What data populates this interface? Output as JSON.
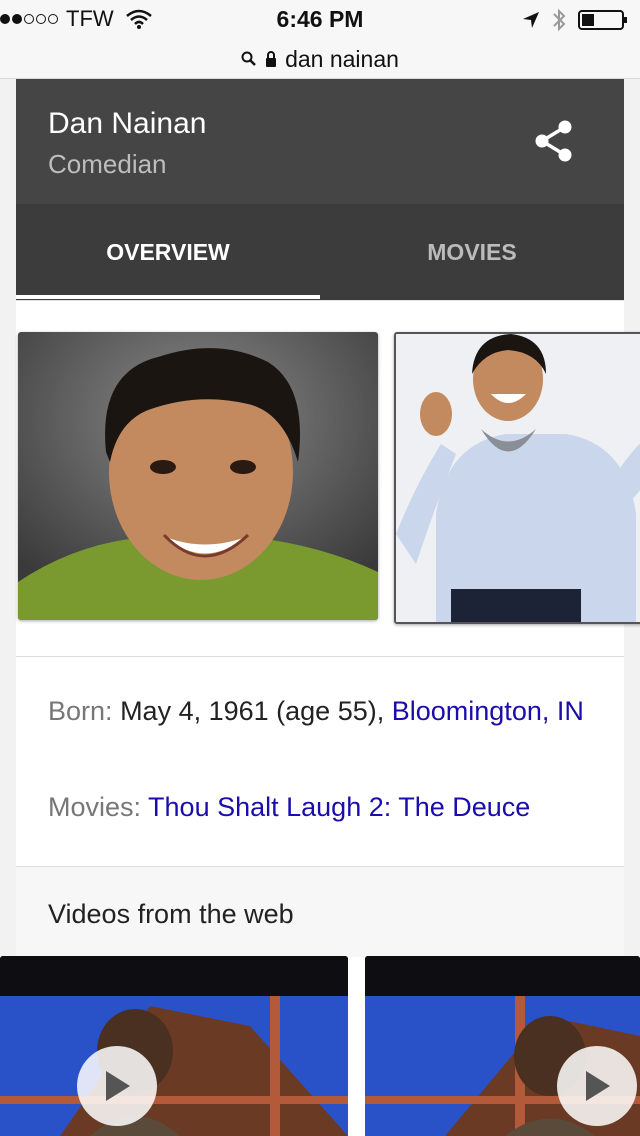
{
  "status": {
    "carrier": "TFW",
    "time": "6:46 PM",
    "signal_dots_filled": 2,
    "signal_dots_total": 5
  },
  "url_bar": {
    "query": "dan nainan"
  },
  "entity": {
    "name": "Dan Nainan",
    "subtitle": "Comedian"
  },
  "tabs": [
    {
      "label": "OVERVIEW",
      "active": true
    },
    {
      "label": "MOVIES",
      "active": false
    }
  ],
  "facts": {
    "born_label": "Born:",
    "born_value": "May 4, 1961 (age 55),",
    "born_place": "Bloomington, IN",
    "movies_label": "Movies:",
    "movies_value": "Thou Shalt Laugh 2: The Deuce"
  },
  "videos": {
    "heading": "Videos from the web"
  },
  "colors": {
    "header_bg": "#454545",
    "tabs_bg": "#3c3c3c",
    "link": "#1a0dab"
  }
}
